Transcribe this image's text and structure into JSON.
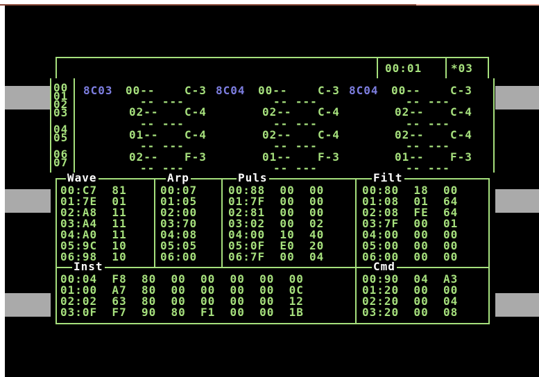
{
  "header": {
    "time": "00:01",
    "song": "*03"
  },
  "rows": [
    "00",
    "01",
    "02",
    "03",
    "04",
    "05",
    "06",
    "07"
  ],
  "tracks": {
    "row0": {
      "c1a": "8C03",
      "c1b": "00--",
      "c1c": "C-3",
      "c2a": "8C04",
      "c2b": "00--",
      "c2c": "C-3",
      "c3a": "8C04",
      "c3b": "00--",
      "c3c": "C-3"
    },
    "row2": {
      "t1": "02--",
      "n1": "C-4",
      "t2": "02--",
      "n2": "C-4",
      "t3": "02--",
      "n3": "C-4"
    },
    "row4": {
      "t1": "01--",
      "n1": "C-4",
      "t2": "02--",
      "n2": "C-4",
      "t3": "02--",
      "n3": "C-4"
    },
    "row6": {
      "t1": "02--",
      "n1": "F-3",
      "t2": "01--",
      "n2": "F-3",
      "t3": "01--",
      "n3": "F-3"
    },
    "blank": "-- ---"
  },
  "tables": {
    "wave": {
      "title": "Wave",
      "rows": [
        "00:C7  81",
        "01:7E  01",
        "02:A8  11",
        "03:A4  11",
        "04:A0  11",
        "05:9C  10",
        "06:98  10"
      ]
    },
    "arp": {
      "title": "Arp",
      "rows": [
        "00:07",
        "01:05",
        "02:00",
        "03:70",
        "04:08",
        "05:05",
        "06:00"
      ]
    },
    "puls": {
      "title": "Puls",
      "rows": [
        "00:88  00  00",
        "01:7F  00  00",
        "02:81  00  00",
        "03:02  00  02",
        "04:00  10  40",
        "05:0F  E0  20",
        "06:7F  00  04"
      ]
    },
    "filt": {
      "title": "Filt",
      "rows": [
        "00:80  18  00",
        "01:08  01  64",
        "02:08  FE  64",
        "03:7F  00  01",
        "04:00  00  00",
        "05:00  00  00",
        "06:00  00  00"
      ]
    },
    "inst": {
      "title": "Inst",
      "rows": [
        "00:04  F8  80  00  00  00  00  00",
        "01:00  A7  80  00  00  00  00  0C",
        "02:02  63  80  00  00  00  00  12",
        "03:0F  F7  90  80  F1  00  00  1B"
      ]
    },
    "cmd": {
      "title": "Cmd",
      "rows": [
        "00:90  04  A3",
        "01:20  00  00",
        "02:20  00  04",
        "03:20  00  08"
      ]
    }
  },
  "colors": {
    "background": "#000000",
    "green": "#a6e07d",
    "white": "#ffffff",
    "blue": "#7d7ee0",
    "side_bars": "#aaaaaa"
  }
}
